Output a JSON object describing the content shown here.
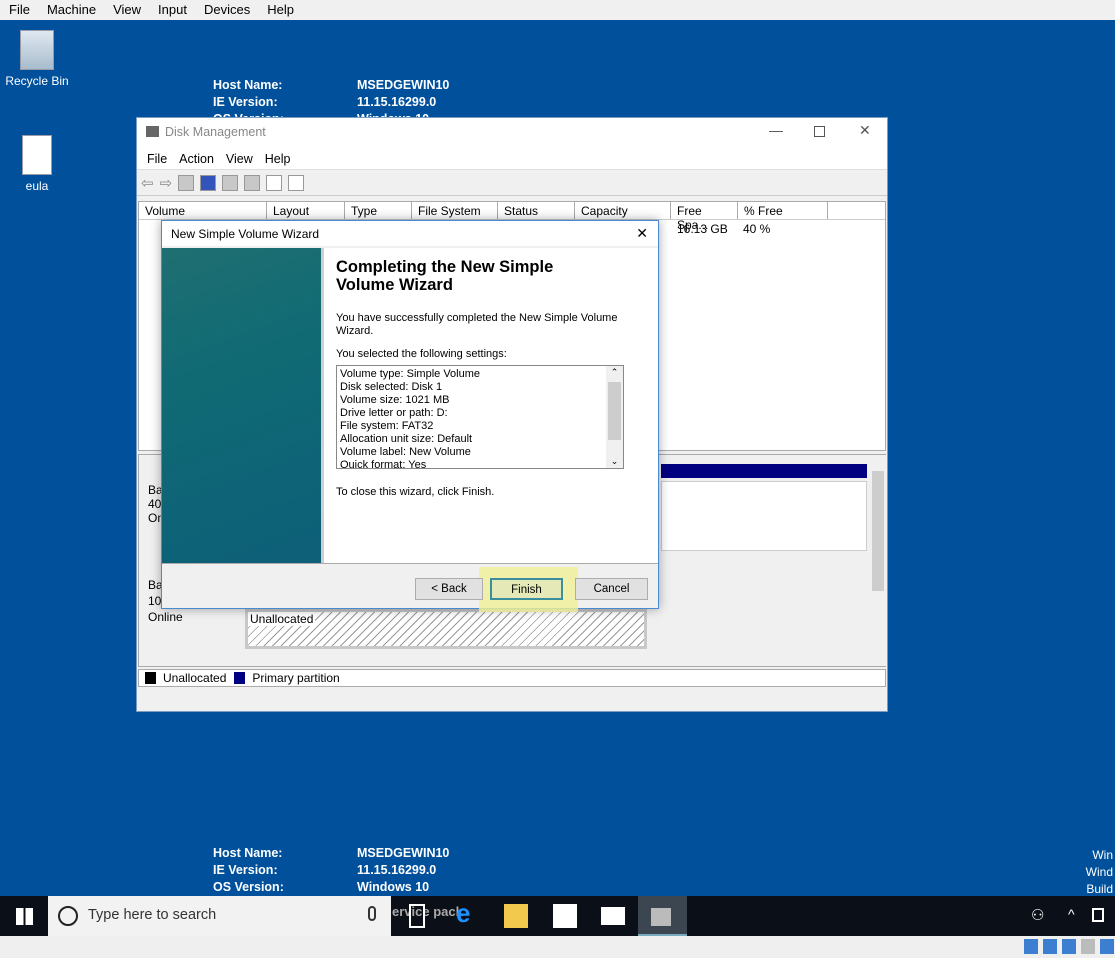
{
  "vbox_menu": [
    "File",
    "Machine",
    "View",
    "Input",
    "Devices",
    "Help"
  ],
  "desktop_icons": [
    {
      "label": "Recycle Bin",
      "icon": "recycle-bin-icon"
    },
    {
      "label": "eula",
      "icon": "document-shortcut-icon"
    }
  ],
  "info_top": {
    "host_label": "Host Name:",
    "host": "MSEDGEWIN10",
    "ie_label": "IE Version:",
    "ie": "11.15.16299.0",
    "os_label": "OS Version:",
    "os": "Windows 10"
  },
  "info_bottom": {
    "host_label": "Host Name:",
    "host": "MSEDGEWIN10",
    "ie_label": "IE Version:",
    "ie": "11.15.16299.0",
    "os_label": "OS Version:",
    "os": "Windows 10",
    "sp_partial": "ervice pack"
  },
  "watermark": [
    "Win",
    "Wind",
    "Build"
  ],
  "disk_mgmt": {
    "title": "Disk Management",
    "menu": [
      "File",
      "Action",
      "View",
      "Help"
    ],
    "columns": [
      "Volume",
      "Layout",
      "Type",
      "File System",
      "Status",
      "Capacity",
      "Free Spa...",
      "% Free"
    ],
    "row": {
      "free": "16.13 GB",
      "pct": "40 %"
    },
    "disk0": {
      "l1": "Ba",
      "l2": "40.",
      "l3": "On"
    },
    "disk1": {
      "l1": "Ba",
      "l2": "10.",
      "l3": "Online",
      "unallocated": "Unallocated"
    },
    "legend": [
      "Unallocated",
      "Primary partition"
    ],
    "colors": {
      "unallocated": "#000000",
      "primary": "#000080"
    }
  },
  "wizard": {
    "title": "New Simple Volume Wizard",
    "heading": "Completing the New Simple Volume Wizard",
    "intro": "You have successfully completed the New Simple Volume Wizard.",
    "settings_label": "You selected the following settings:",
    "settings": [
      "Volume type: Simple Volume",
      "Disk selected: Disk 1",
      "Volume size: 1021 MB",
      "Drive letter or path: D:",
      "File system: FAT32",
      "Allocation unit size: Default",
      "Volume label: New Volume",
      "Quick format: Yes"
    ],
    "close_text": "To close this wizard, click Finish.",
    "back": "< Back",
    "finish": "Finish",
    "cancel": "Cancel"
  },
  "taskbar": {
    "search_placeholder": "Type here to search"
  }
}
